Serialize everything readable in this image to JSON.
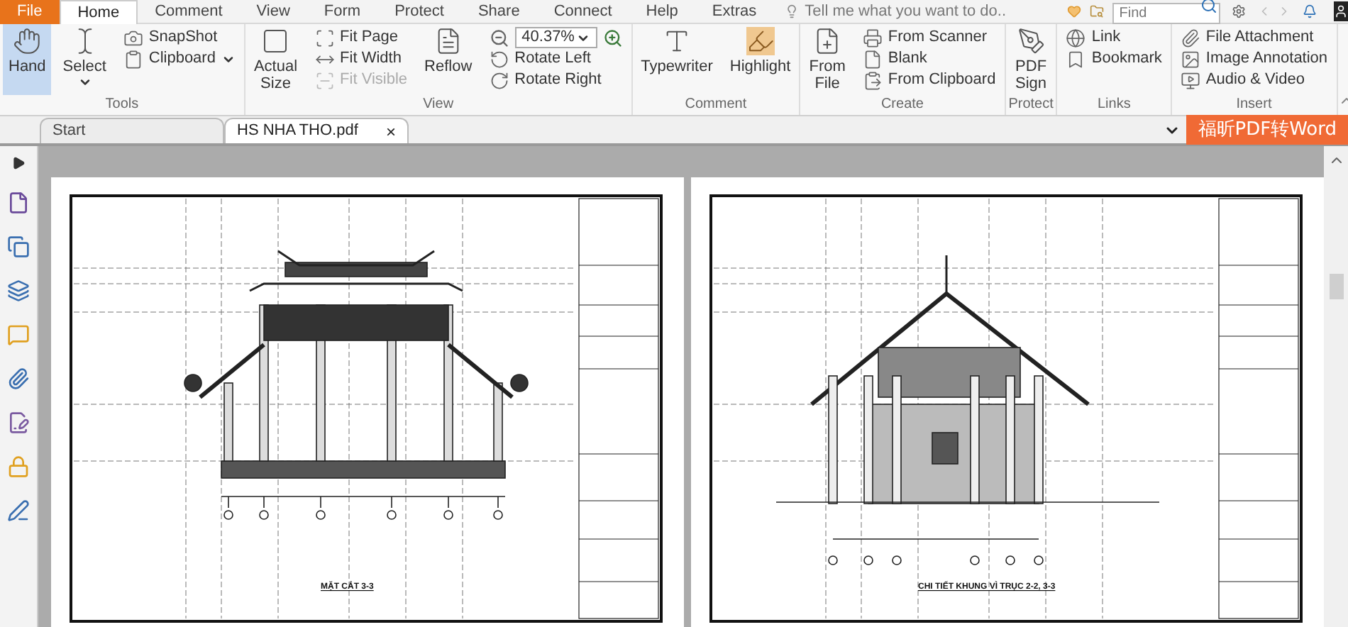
{
  "menu_tabs": [
    {
      "label": "File",
      "kind": "file",
      "selected": false
    },
    {
      "label": "Home",
      "kind": "tab",
      "selected": true
    },
    {
      "label": "Comment",
      "kind": "tab",
      "selected": false
    },
    {
      "label": "View",
      "kind": "tab",
      "selected": false
    },
    {
      "label": "Form",
      "kind": "tab",
      "selected": false
    },
    {
      "label": "Protect",
      "kind": "tab",
      "selected": false
    },
    {
      "label": "Share",
      "kind": "tab",
      "selected": false
    },
    {
      "label": "Connect",
      "kind": "tab",
      "selected": false
    },
    {
      "label": "Help",
      "kind": "tab",
      "selected": false
    },
    {
      "label": "Extras",
      "kind": "tab",
      "selected": false
    }
  ],
  "tell_me": {
    "placeholder": "Tell me what you want to do.."
  },
  "find": {
    "placeholder": "Find"
  },
  "ribbon": [
    {
      "label": "Tools",
      "items": [
        {
          "kind": "large",
          "label": "Hand",
          "selected": true,
          "caret": false
        },
        {
          "kind": "large",
          "label": "Select",
          "selected": false,
          "caret": true
        },
        {
          "kind": "column",
          "tools": [
            {
              "kind": "small",
              "label": "SnapShot",
              "disabled": false,
              "caret": false
            },
            {
              "kind": "small",
              "label": "Clipboard",
              "disabled": false,
              "caret": true
            }
          ]
        }
      ]
    },
    {
      "label": "View",
      "items": [
        {
          "kind": "large",
          "label": "Actual Size",
          "selected": false,
          "caret": false
        },
        {
          "kind": "column",
          "tools": [
            {
              "kind": "small",
              "label": "Fit Page",
              "disabled": false,
              "caret": false
            },
            {
              "kind": "small",
              "label": "Fit Width",
              "disabled": false,
              "caret": false
            },
            {
              "kind": "small",
              "label": "Fit Visible",
              "disabled": true,
              "caret": false
            }
          ]
        },
        {
          "kind": "large",
          "label": "Reflow",
          "selected": false,
          "caret": false
        },
        {
          "kind": "column",
          "tools": [
            {
              "kind": "zoom",
              "value": "40.37%"
            },
            {
              "kind": "small",
              "label": "Rotate Left",
              "disabled": false,
              "caret": false
            },
            {
              "kind": "small",
              "label": "Rotate Right",
              "disabled": false,
              "caret": false
            }
          ]
        }
      ]
    },
    {
      "label": "Comment",
      "items": [
        {
          "kind": "large",
          "label": "Typewriter",
          "selected": false,
          "caret": false
        },
        {
          "kind": "large",
          "label": "Highlight",
          "selected": false,
          "caret": false
        }
      ]
    },
    {
      "label": "Create",
      "items": [
        {
          "kind": "large",
          "label": "From File",
          "selected": false,
          "caret": false
        },
        {
          "kind": "column",
          "tools": [
            {
              "kind": "small",
              "label": "From Scanner",
              "disabled": false,
              "caret": false
            },
            {
              "kind": "small",
              "label": "Blank",
              "disabled": false,
              "caret": false
            },
            {
              "kind": "small",
              "label": "From Clipboard",
              "disabled": false,
              "caret": false
            }
          ]
        }
      ]
    },
    {
      "label": "Protect",
      "items": [
        {
          "kind": "large",
          "label": "PDF Sign",
          "selected": false,
          "caret": false
        }
      ]
    },
    {
      "label": "Links",
      "items": [
        {
          "kind": "column",
          "tools": [
            {
              "kind": "small",
              "label": "Link",
              "disabled": false,
              "caret": false
            },
            {
              "kind": "small",
              "label": "Bookmark",
              "disabled": false,
              "caret": false
            }
          ]
        }
      ]
    },
    {
      "label": "Insert",
      "items": [
        {
          "kind": "column",
          "tools": [
            {
              "kind": "small",
              "label": "File Attachment",
              "disabled": false,
              "caret": false
            },
            {
              "kind": "small",
              "label": "Image Annotation",
              "disabled": false,
              "caret": false
            },
            {
              "kind": "small",
              "label": "Audio & Video",
              "disabled": false,
              "caret": false
            }
          ]
        }
      ]
    }
  ],
  "doc_tabs": [
    {
      "label": "Start",
      "selected": false
    },
    {
      "label": "HS NHA THO.pdf",
      "selected": true,
      "close": "×"
    }
  ],
  "promo_button": "福昕PDF转Word",
  "pages": [
    {
      "kind": "gate",
      "caption": "MẶT CẮT 3-3"
    },
    {
      "kind": "house",
      "caption": "CHI TIẾT KHUNG VÌ TRỤC 2-2, 3-3"
    }
  ]
}
